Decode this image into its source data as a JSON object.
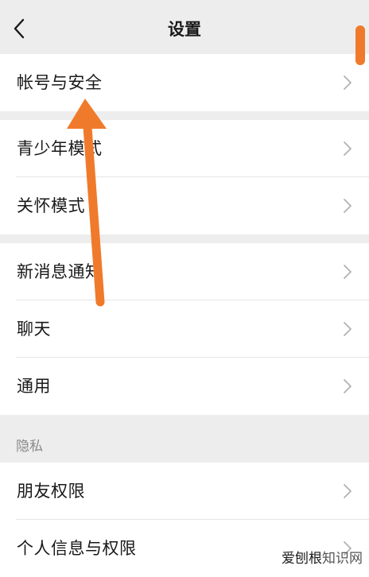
{
  "header": {
    "title": "设置",
    "back_icon": "chevron-left-icon"
  },
  "groups": [
    {
      "items": [
        {
          "label": "帐号与安全"
        }
      ]
    },
    {
      "items": [
        {
          "label": "青少年模式"
        },
        {
          "label": "关怀模式"
        }
      ]
    },
    {
      "items": [
        {
          "label": "新消息通知"
        },
        {
          "label": "聊天"
        },
        {
          "label": "通用"
        }
      ]
    }
  ],
  "privacy_section": {
    "title": "隐私",
    "items": [
      {
        "label": "朋友权限"
      },
      {
        "label": "个人信息与权限"
      }
    ]
  },
  "item_icon": "chevron-right-icon",
  "annotation": {
    "arrow_color": "#f07a2b",
    "target": "帐号与安全"
  },
  "watermark": {
    "part1": "爱刨根",
    "part2": "知识网"
  },
  "colors": {
    "background": "#ededed",
    "card": "#ffffff",
    "divider": "#e5e5e5",
    "accent": "#f07a2b"
  }
}
